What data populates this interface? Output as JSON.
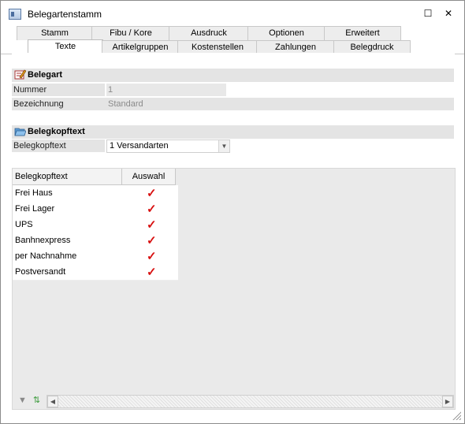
{
  "window": {
    "title": "Belegartenstamm",
    "minimize_glyph": "☐",
    "close_glyph": "✕"
  },
  "tabs_row1": [
    {
      "label": "Stamm"
    },
    {
      "label": "Fibu / Kore"
    },
    {
      "label": "Ausdruck"
    },
    {
      "label": "Optionen"
    },
    {
      "label": "Erweitert"
    }
  ],
  "tabs_row2": [
    {
      "label": "Texte",
      "active": true
    },
    {
      "label": "Artikelgruppen"
    },
    {
      "label": "Kostenstellen"
    },
    {
      "label": "Zahlungen"
    },
    {
      "label": "Belegdruck"
    }
  ],
  "belegart": {
    "title": "Belegart",
    "icon": "pencil-edit-icon",
    "nummer_label": "Nummer",
    "nummer_value": "1",
    "bezeichnung_label": "Bezeichnung",
    "bezeichnung_value": "Standard"
  },
  "belegkopftext": {
    "title": "Belegkopftext",
    "icon": "folder-open-icon",
    "field_label": "Belegkopftext",
    "field_value": "1 Versandarten"
  },
  "grid": {
    "columns": [
      "Belegkopftext",
      "Auswahl"
    ],
    "rows": [
      {
        "name": "Frei Haus",
        "check": "✓"
      },
      {
        "name": "Frei Lager",
        "check": "✓"
      },
      {
        "name": "UPS",
        "check": "✓"
      },
      {
        "name": "Banhnexpress",
        "check": "✓"
      },
      {
        "name": "per Nachnahme",
        "check": "✓"
      },
      {
        "name": "Postversandt",
        "check": "✓"
      }
    ]
  },
  "colors": {
    "accent_check": "#d81010",
    "section_bg": "#e4e4e4"
  }
}
